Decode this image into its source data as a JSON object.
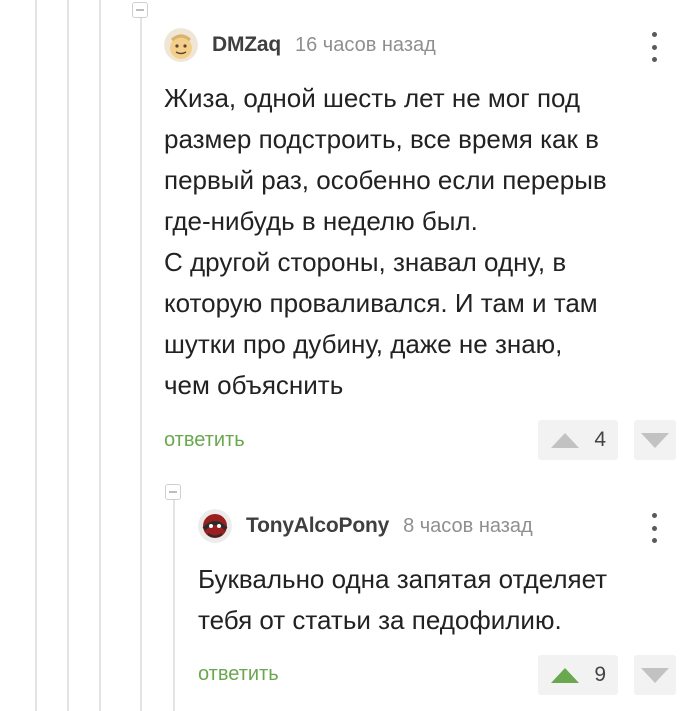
{
  "comments": [
    {
      "author": "DMZaq",
      "time": "16 часов назад",
      "text": "Жиза, одной шесть лет не мог под\nразмер подстроить, все время как в\nпервый раз, особенно если перерыв\nгде-нибудь в неделю был.\nС другой стороны, знавал одну, в\nкоторую проваливался. И там и там\nшутки про дубину, даже не знаю,\nчем объяснить",
      "reply_label": "ответить",
      "rating": "4",
      "upvoted": false
    },
    {
      "author": "TonyAlcoPony",
      "time": "8 часов назад",
      "text": "Буквально одна запятая отделяет\nтебя от статьи за педофилию.",
      "reply_label": "ответить",
      "rating": "9",
      "upvoted": true
    }
  ],
  "icons": {
    "collapse": "minus-square-icon",
    "more": "vertical-dots-icon",
    "upvote": "triangle-up-icon",
    "downvote": "triangle-down-icon"
  },
  "colors": {
    "reply_link": "#6aa84f",
    "upvote_active": "#6aa84f",
    "vote_inactive": "#c2c2c2",
    "time": "#8f8f8f",
    "thread_line": "#e4e4e4"
  }
}
